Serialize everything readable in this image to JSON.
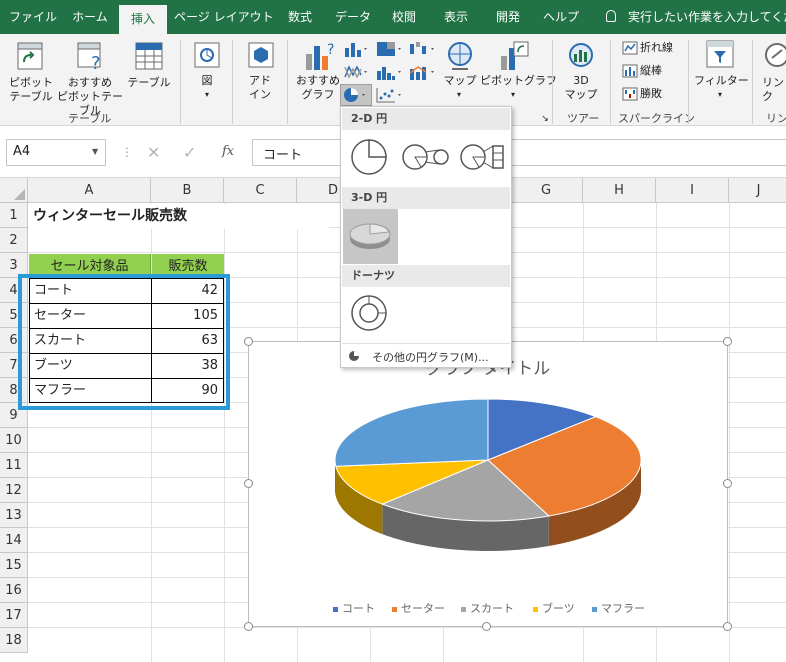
{
  "ribbon_tabs": [
    "ファイル",
    "ホーム",
    "挿入",
    "ページ レイアウト",
    "数式",
    "データ",
    "校閲",
    "表示",
    "開発",
    "ヘルプ"
  ],
  "tell_me": "実行したい作業を入力してください",
  "ribbon": {
    "pivot_table": "ピボット\nテーブル",
    "recommended_pivot": "おすすめ\nピボットテーブル",
    "table": "テーブル",
    "illustrations": "図",
    "addins": "アド\nイン",
    "recommended_charts": "おすすめ\nグラフ",
    "maps": "マップ",
    "pivot_chart": "ピボットグラフ",
    "map3d": "3D\nマップ",
    "line": "折れ線",
    "column": "縦棒",
    "winloss": "勝敗",
    "filter": "フィルター",
    "link": "リン\nク",
    "group_table": "テーブル",
    "group_tour": "ツアー",
    "group_sparkline": "スパークライン",
    "group_link": "リン"
  },
  "name_box": "A4",
  "formula_value": "コート",
  "fx": "fx",
  "columns": [
    "A",
    "B",
    "C",
    "D",
    "E",
    "F",
    "G",
    "H",
    "I",
    "J"
  ],
  "rows": [
    "1",
    "2",
    "3",
    "4",
    "5",
    "6",
    "7",
    "8",
    "9",
    "10",
    "11",
    "12",
    "13",
    "14",
    "15",
    "16",
    "17",
    "18"
  ],
  "sheet": {
    "title": "ウィンターセール販売数",
    "header_item": "セール対象品",
    "header_count": "販売数",
    "items": [
      {
        "name": "コート",
        "count": "42"
      },
      {
        "name": "セーター",
        "count": "105"
      },
      {
        "name": "スカート",
        "count": "63"
      },
      {
        "name": "ブーツ",
        "count": "38"
      },
      {
        "name": "マフラー",
        "count": "90"
      }
    ]
  },
  "dropdown": {
    "sec_2d": "2-D 円",
    "sec_3d": "3-D 円",
    "sec_donut": "ドーナツ",
    "more": "その他の円グラフ(M)..."
  },
  "colors": {
    "excel_green": "#217346",
    "header_fill": "#92d050",
    "selection": "#2b9bd8"
  },
  "chart_data": {
    "type": "pie",
    "title": "グラフ タイトル",
    "categories": [
      "コート",
      "セーター",
      "スカート",
      "ブーツ",
      "マフラー"
    ],
    "values": [
      42,
      105,
      63,
      38,
      90
    ],
    "colors": [
      "#4472c4",
      "#ed7d31",
      "#a5a5a5",
      "#ffc000",
      "#5b9bd5"
    ],
    "legend_position": "bottom",
    "style": "3-D"
  }
}
